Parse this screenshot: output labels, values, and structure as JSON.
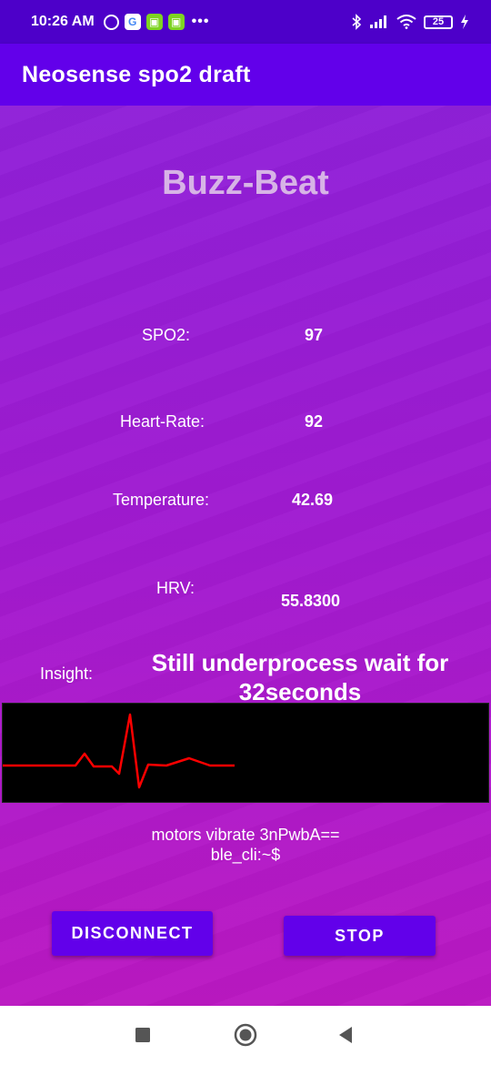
{
  "status_bar": {
    "time": "10:26 AM",
    "battery": "25",
    "left_icons": [
      "alarm-icon",
      "google-icon",
      "app-icon",
      "app-icon",
      "more-dots-icon"
    ],
    "right_icons": [
      "bluetooth-icon",
      "signal-icon",
      "wifi-icon",
      "battery-icon",
      "charging-icon"
    ]
  },
  "app_bar": {
    "title": "Neosense spo2 draft"
  },
  "main": {
    "heading": "Buzz-Beat",
    "spo2": {
      "label": "SPO2:",
      "value": "97"
    },
    "heart_rate": {
      "label": "Heart-Rate:",
      "value": "92"
    },
    "temperature": {
      "label": "Temperature:",
      "value": "42.69"
    },
    "hrv": {
      "label": "HRV:",
      "value": "55.8300"
    },
    "insight": {
      "label": "Insight:",
      "value": "Still underprocess wait for 32seconds"
    },
    "ecg_color": "#ff0000",
    "ble_line1": "motors vibrate 3nPwbA==",
    "ble_line2": "ble_cli:~$"
  },
  "buttons": {
    "disconnect": "DISCONNECT",
    "stop": "STOP"
  },
  "nav_bar": {
    "icons": [
      "recents-square-icon",
      "home-circle-icon",
      "back-triangle-icon"
    ]
  },
  "colors": {
    "status_bar": "#4d00c9",
    "app_bar": "#6200ea",
    "button": "#6200ea",
    "heading": "#d7b3e6"
  }
}
